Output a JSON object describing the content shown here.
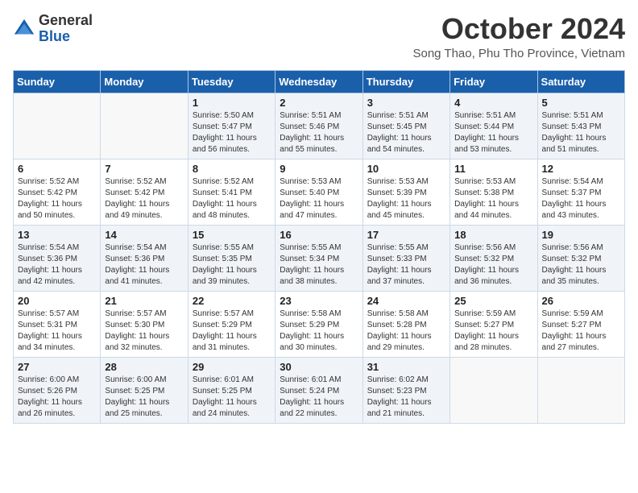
{
  "header": {
    "logo_general": "General",
    "logo_blue": "Blue",
    "month_title": "October 2024",
    "location": "Song Thao, Phu Tho Province, Vietnam"
  },
  "calendar": {
    "days_of_week": [
      "Sunday",
      "Monday",
      "Tuesday",
      "Wednesday",
      "Thursday",
      "Friday",
      "Saturday"
    ],
    "weeks": [
      [
        {
          "day": "",
          "info": ""
        },
        {
          "day": "",
          "info": ""
        },
        {
          "day": "1",
          "info": "Sunrise: 5:50 AM\nSunset: 5:47 PM\nDaylight: 11 hours and 56 minutes."
        },
        {
          "day": "2",
          "info": "Sunrise: 5:51 AM\nSunset: 5:46 PM\nDaylight: 11 hours and 55 minutes."
        },
        {
          "day": "3",
          "info": "Sunrise: 5:51 AM\nSunset: 5:45 PM\nDaylight: 11 hours and 54 minutes."
        },
        {
          "day": "4",
          "info": "Sunrise: 5:51 AM\nSunset: 5:44 PM\nDaylight: 11 hours and 53 minutes."
        },
        {
          "day": "5",
          "info": "Sunrise: 5:51 AM\nSunset: 5:43 PM\nDaylight: 11 hours and 51 minutes."
        }
      ],
      [
        {
          "day": "6",
          "info": "Sunrise: 5:52 AM\nSunset: 5:42 PM\nDaylight: 11 hours and 50 minutes."
        },
        {
          "day": "7",
          "info": "Sunrise: 5:52 AM\nSunset: 5:42 PM\nDaylight: 11 hours and 49 minutes."
        },
        {
          "day": "8",
          "info": "Sunrise: 5:52 AM\nSunset: 5:41 PM\nDaylight: 11 hours and 48 minutes."
        },
        {
          "day": "9",
          "info": "Sunrise: 5:53 AM\nSunset: 5:40 PM\nDaylight: 11 hours and 47 minutes."
        },
        {
          "day": "10",
          "info": "Sunrise: 5:53 AM\nSunset: 5:39 PM\nDaylight: 11 hours and 45 minutes."
        },
        {
          "day": "11",
          "info": "Sunrise: 5:53 AM\nSunset: 5:38 PM\nDaylight: 11 hours and 44 minutes."
        },
        {
          "day": "12",
          "info": "Sunrise: 5:54 AM\nSunset: 5:37 PM\nDaylight: 11 hours and 43 minutes."
        }
      ],
      [
        {
          "day": "13",
          "info": "Sunrise: 5:54 AM\nSunset: 5:36 PM\nDaylight: 11 hours and 42 minutes."
        },
        {
          "day": "14",
          "info": "Sunrise: 5:54 AM\nSunset: 5:36 PM\nDaylight: 11 hours and 41 minutes."
        },
        {
          "day": "15",
          "info": "Sunrise: 5:55 AM\nSunset: 5:35 PM\nDaylight: 11 hours and 39 minutes."
        },
        {
          "day": "16",
          "info": "Sunrise: 5:55 AM\nSunset: 5:34 PM\nDaylight: 11 hours and 38 minutes."
        },
        {
          "day": "17",
          "info": "Sunrise: 5:55 AM\nSunset: 5:33 PM\nDaylight: 11 hours and 37 minutes."
        },
        {
          "day": "18",
          "info": "Sunrise: 5:56 AM\nSunset: 5:32 PM\nDaylight: 11 hours and 36 minutes."
        },
        {
          "day": "19",
          "info": "Sunrise: 5:56 AM\nSunset: 5:32 PM\nDaylight: 11 hours and 35 minutes."
        }
      ],
      [
        {
          "day": "20",
          "info": "Sunrise: 5:57 AM\nSunset: 5:31 PM\nDaylight: 11 hours and 34 minutes."
        },
        {
          "day": "21",
          "info": "Sunrise: 5:57 AM\nSunset: 5:30 PM\nDaylight: 11 hours and 32 minutes."
        },
        {
          "day": "22",
          "info": "Sunrise: 5:57 AM\nSunset: 5:29 PM\nDaylight: 11 hours and 31 minutes."
        },
        {
          "day": "23",
          "info": "Sunrise: 5:58 AM\nSunset: 5:29 PM\nDaylight: 11 hours and 30 minutes."
        },
        {
          "day": "24",
          "info": "Sunrise: 5:58 AM\nSunset: 5:28 PM\nDaylight: 11 hours and 29 minutes."
        },
        {
          "day": "25",
          "info": "Sunrise: 5:59 AM\nSunset: 5:27 PM\nDaylight: 11 hours and 28 minutes."
        },
        {
          "day": "26",
          "info": "Sunrise: 5:59 AM\nSunset: 5:27 PM\nDaylight: 11 hours and 27 minutes."
        }
      ],
      [
        {
          "day": "27",
          "info": "Sunrise: 6:00 AM\nSunset: 5:26 PM\nDaylight: 11 hours and 26 minutes."
        },
        {
          "day": "28",
          "info": "Sunrise: 6:00 AM\nSunset: 5:25 PM\nDaylight: 11 hours and 25 minutes."
        },
        {
          "day": "29",
          "info": "Sunrise: 6:01 AM\nSunset: 5:25 PM\nDaylight: 11 hours and 24 minutes."
        },
        {
          "day": "30",
          "info": "Sunrise: 6:01 AM\nSunset: 5:24 PM\nDaylight: 11 hours and 22 minutes."
        },
        {
          "day": "31",
          "info": "Sunrise: 6:02 AM\nSunset: 5:23 PM\nDaylight: 11 hours and 21 minutes."
        },
        {
          "day": "",
          "info": ""
        },
        {
          "day": "",
          "info": ""
        }
      ]
    ]
  }
}
